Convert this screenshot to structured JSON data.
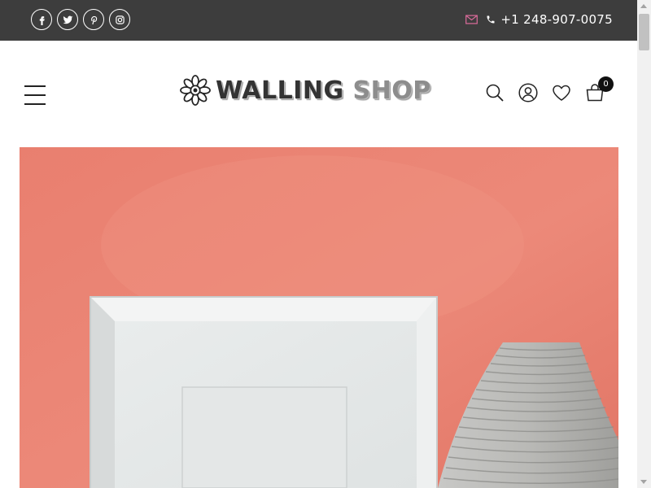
{
  "topbar": {
    "social": [
      {
        "icon": "facebook-icon"
      },
      {
        "icon": "twitter-icon"
      },
      {
        "icon": "pinterest-icon"
      },
      {
        "icon": "instagram-icon"
      }
    ],
    "mail_icon": "envelope-icon",
    "mail_color": "#d96b9a",
    "phone_icon": "phone-icon",
    "phone": "+1 248-907-0075",
    "background": "#3d3d3d"
  },
  "header": {
    "menu_icon": "hamburger-menu-icon",
    "logo": {
      "word1": "WALLING",
      "word2": "SHOP",
      "mark_icon": "flower-logo-icon"
    },
    "icons": [
      "search-icon",
      "user-icon",
      "heart-icon",
      "cart-icon"
    ],
    "cart_count": "0"
  },
  "hero": {
    "wall_color": "#e87d6e",
    "image_subject": "white-frame-and-ribbed-vase"
  }
}
